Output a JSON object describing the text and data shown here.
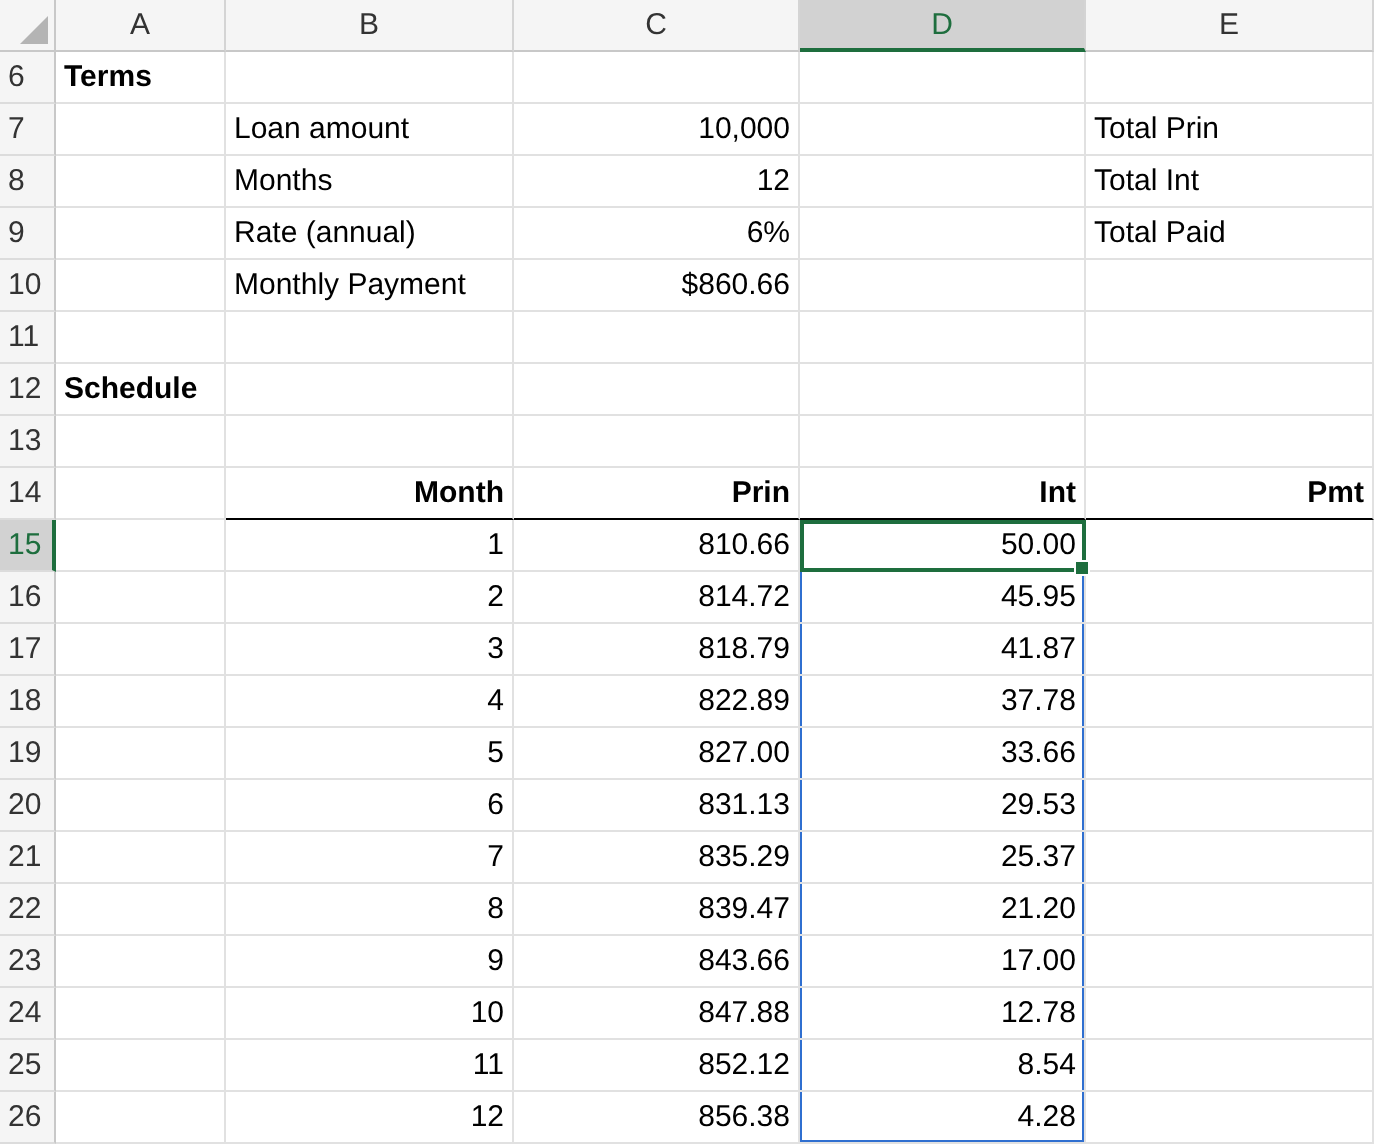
{
  "columns": [
    {
      "label": "A",
      "selected": false
    },
    {
      "label": "B",
      "selected": false
    },
    {
      "label": "C",
      "selected": false
    },
    {
      "label": "D",
      "selected": true
    },
    {
      "label": "E",
      "selected": false
    }
  ],
  "rows": [
    {
      "number": "6",
      "kind": "section",
      "selected": false,
      "in_range": false,
      "a": "Terms"
    },
    {
      "number": "7",
      "kind": "terms",
      "selected": false,
      "in_range": false,
      "b": "Loan amount",
      "c": "10,000",
      "e": "Total Prin"
    },
    {
      "number": "8",
      "kind": "terms",
      "selected": false,
      "in_range": false,
      "b": "Months",
      "c": "12",
      "e": "Total Int"
    },
    {
      "number": "9",
      "kind": "terms",
      "selected": false,
      "in_range": false,
      "b": "Rate (annual)",
      "c": "6%",
      "e": "Total Paid"
    },
    {
      "number": "10",
      "kind": "terms",
      "selected": false,
      "in_range": false,
      "b": "Monthly Payment",
      "c": "$860.66"
    },
    {
      "number": "11",
      "kind": "blank",
      "selected": false,
      "in_range": false
    },
    {
      "number": "12",
      "kind": "section",
      "selected": false,
      "in_range": false,
      "a": "Schedule"
    },
    {
      "number": "13",
      "kind": "blank",
      "selected": false,
      "in_range": false
    },
    {
      "number": "14",
      "kind": "header",
      "selected": false,
      "in_range": false,
      "b": "Month",
      "c": "Prin",
      "d": "Int",
      "e": "Pmt"
    },
    {
      "number": "15",
      "kind": "data",
      "selected": true,
      "in_range": true,
      "b": "1",
      "c": "810.66",
      "d": "50.00"
    },
    {
      "number": "16",
      "kind": "data",
      "selected": false,
      "in_range": true,
      "b": "2",
      "c": "814.72",
      "d": "45.95"
    },
    {
      "number": "17",
      "kind": "data",
      "selected": false,
      "in_range": true,
      "b": "3",
      "c": "818.79",
      "d": "41.87"
    },
    {
      "number": "18",
      "kind": "data",
      "selected": false,
      "in_range": true,
      "b": "4",
      "c": "822.89",
      "d": "37.78"
    },
    {
      "number": "19",
      "kind": "data",
      "selected": false,
      "in_range": true,
      "b": "5",
      "c": "827.00",
      "d": "33.66"
    },
    {
      "number": "20",
      "kind": "data",
      "selected": false,
      "in_range": true,
      "b": "6",
      "c": "831.13",
      "d": "29.53"
    },
    {
      "number": "21",
      "kind": "data",
      "selected": false,
      "in_range": true,
      "b": "7",
      "c": "835.29",
      "d": "25.37"
    },
    {
      "number": "22",
      "kind": "data",
      "selected": false,
      "in_range": true,
      "b": "8",
      "c": "839.47",
      "d": "21.20"
    },
    {
      "number": "23",
      "kind": "data",
      "selected": false,
      "in_range": true,
      "b": "9",
      "c": "843.66",
      "d": "17.00"
    },
    {
      "number": "24",
      "kind": "data",
      "selected": false,
      "in_range": true,
      "b": "10",
      "c": "847.88",
      "d": "12.78"
    },
    {
      "number": "25",
      "kind": "data",
      "selected": false,
      "in_range": true,
      "b": "11",
      "c": "852.12",
      "d": "8.54"
    },
    {
      "number": "26",
      "kind": "data",
      "selected": false,
      "in_range": true,
      "b": "12",
      "c": "856.38",
      "d": "4.28"
    }
  ]
}
